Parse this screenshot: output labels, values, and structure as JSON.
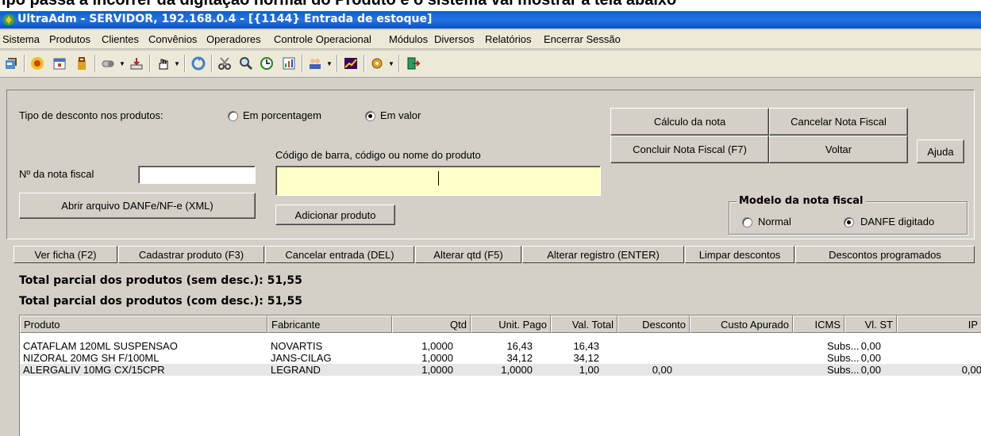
{
  "caption_fragment": "ipo passa a incorrer da digitação normal do Produto e o sistema vai mostrar a tela abaixo",
  "window": {
    "title": "UltraAdm - SERVIDOR, 192.168.0.4 - [{1144} Entrada de estoque]"
  },
  "menu": [
    "Sistema",
    "Produtos",
    "Clientes",
    "Convênios",
    "Operadores",
    "Controle Operacional",
    "Módulos",
    "Diversos",
    "Relatórios",
    "Encerrar Sessão"
  ],
  "discount": {
    "label": "Tipo de desconto nos produtos:",
    "option_percent": "Em porcentagem",
    "option_value": "Em valor",
    "selected": "Em valor"
  },
  "invoice": {
    "number_label": "Nº da nota fiscal",
    "number_value": "",
    "open_xml_button": "Abrir arquivo DANFe/NF-e (XML)"
  },
  "product_search": {
    "label": "Código de barra, código ou nome do produto",
    "value": "",
    "add_button": "Adicionar produto"
  },
  "actions": {
    "calc": "Cálculo da nota",
    "cancel_invoice": "Cancelar Nota Fiscal",
    "finish": "Concluir Nota Fiscal (F7)",
    "back": "Voltar",
    "help": "Ajuda"
  },
  "model": {
    "title": "Modelo da nota fiscal",
    "normal": "Normal",
    "danfe": "DANFE digitado",
    "selected": "DANFE digitado"
  },
  "action_bar": [
    "Ver ficha (F2)",
    "Cadastrar produto (F3)",
    "Cancelar entrada (DEL)",
    "Alterar qtd (F5)",
    "Alterar registro (ENTER)",
    "Limpar descontos",
    "Descontos programados"
  ],
  "totals": {
    "without_discount": "Total parcial dos produtos (sem desc.): 51,55",
    "with_discount": "Total parcial dos produtos (com desc.): 51,55"
  },
  "table": {
    "columns": [
      "Produto",
      "Fabricante",
      "Qtd",
      "Unit. Pago",
      "Val. Total",
      "Desconto",
      "Custo Apurado",
      "ICMS",
      "Vl. ST",
      "IP"
    ],
    "rows": [
      [
        "CATAFLAM 120ML SUSPENSAO",
        "NOVARTIS",
        "1,0000",
        "16,43",
        "16,43",
        "",
        "",
        "Subs...",
        "0,00",
        ""
      ],
      [
        "NIZORAL 20MG SH F/100ML",
        "JANS-CILAG",
        "1,0000",
        "34,12",
        "34,12",
        "",
        "",
        "Subs...",
        "0,00",
        ""
      ],
      [
        "ALERGALIV 10MG CX/15CPR",
        "LEGRAND",
        "1,0000",
        "1,0000",
        "1,00",
        "0,00",
        "",
        "Subs...",
        "0,00",
        "0,00"
      ]
    ]
  },
  "colors": {
    "title_bar": "#0a5fd8",
    "search_field": "#ffffc8",
    "window_face": "#d4d0c8"
  }
}
